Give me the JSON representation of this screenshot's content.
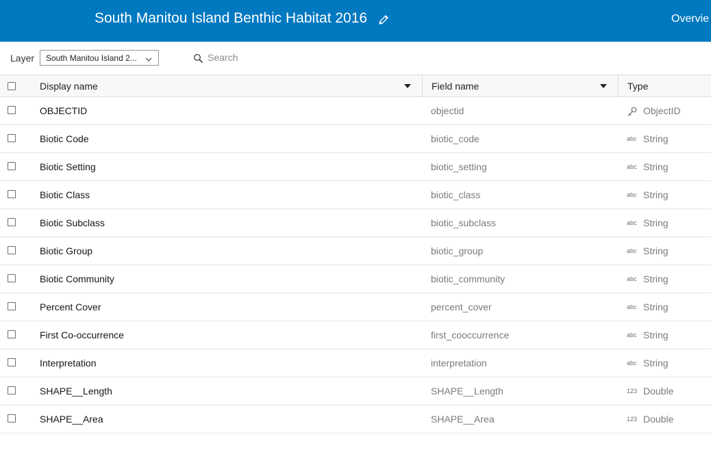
{
  "header": {
    "title": "South Manitou Island Benthic Habitat 2016",
    "edit_icon": "pencil-icon",
    "nav_item": "Overvie",
    "background": "#0079c1"
  },
  "toolbar": {
    "layer_label": "Layer",
    "layer_value": "South Manitou Island 2...",
    "search_placeholder": "Search"
  },
  "table": {
    "headers": {
      "display_name": "Display name",
      "field_name": "Field name",
      "type": "Type"
    },
    "rows": [
      {
        "display": "OBJECTID",
        "field": "objectid",
        "type": "ObjectID",
        "icon": "key-icon"
      },
      {
        "display": "Biotic Code",
        "field": "biotic_code",
        "type": "String",
        "icon": "abc"
      },
      {
        "display": "Biotic Setting",
        "field": "biotic_setting",
        "type": "String",
        "icon": "abc"
      },
      {
        "display": "Biotic Class",
        "field": "biotic_class",
        "type": "String",
        "icon": "abc"
      },
      {
        "display": "Biotic Subclass",
        "field": "biotic_subclass",
        "type": "String",
        "icon": "abc"
      },
      {
        "display": "Biotic Group",
        "field": "biotic_group",
        "type": "String",
        "icon": "abc"
      },
      {
        "display": "Biotic Community",
        "field": "biotic_community",
        "type": "String",
        "icon": "abc"
      },
      {
        "display": "Percent Cover",
        "field": "percent_cover",
        "type": "String",
        "icon": "abc"
      },
      {
        "display": "First Co-occurrence",
        "field": "first_cooccurrence",
        "type": "String",
        "icon": "abc"
      },
      {
        "display": "Interpretation",
        "field": "interpretation",
        "type": "String",
        "icon": "abc"
      },
      {
        "display": "SHAPE__Length",
        "field": "SHAPE__Length",
        "type": "Double",
        "icon": "123"
      },
      {
        "display": "SHAPE__Area",
        "field": "SHAPE__Area",
        "type": "Double",
        "icon": "123"
      }
    ]
  }
}
